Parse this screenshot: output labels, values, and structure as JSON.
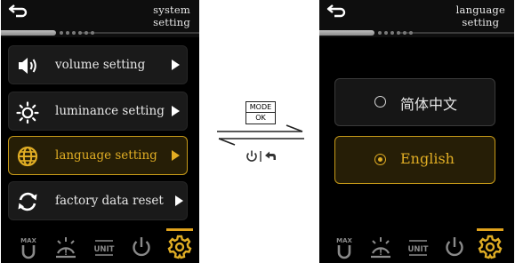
{
  "left_screen": {
    "title_line1": "system",
    "title_line2": "setting",
    "menu": [
      {
        "label": "volume setting",
        "icon": "speaker-icon"
      },
      {
        "label": "luminance setting",
        "icon": "sun-icon"
      },
      {
        "label": "language setting",
        "icon": "globe-icon",
        "selected": true
      },
      {
        "label": "factory data reset",
        "icon": "reset-icon"
      }
    ],
    "bottom_icons": [
      "max-icon",
      "speed-alarm-icon",
      "unit-icon",
      "power-icon",
      "settings-gear-icon"
    ],
    "active_bottom": "settings-gear-icon"
  },
  "middle": {
    "mode_label": "MODE",
    "ok_label": "OK"
  },
  "right_screen": {
    "title_line1": "language",
    "title_line2": "setting",
    "options": [
      {
        "label": "简体中文",
        "selected": false
      },
      {
        "label": "English",
        "selected": true
      }
    ]
  },
  "colors": {
    "accent": "#e0ad24",
    "screen_bg": "#000000",
    "item_bg": "#1a1a1a",
    "selected_bg": "#261e06"
  }
}
